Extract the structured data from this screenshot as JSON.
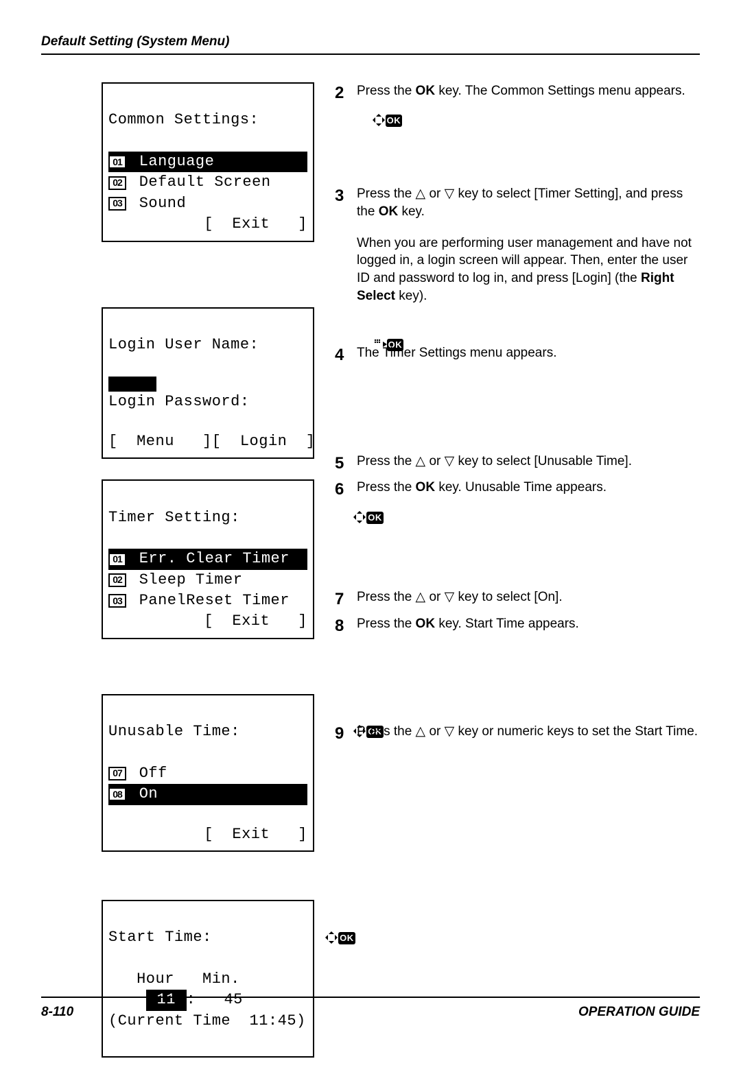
{
  "header": "Default Setting (System Menu)",
  "footer": {
    "page": "8-110",
    "guide": "OPERATION GUIDE"
  },
  "lcd1": {
    "title": "Common Settings:",
    "items": [
      {
        "num": "01",
        "label": " Language",
        "sel": true
      },
      {
        "num": "02",
        "label": " Default Screen",
        "sel": false
      },
      {
        "num": "03",
        "label": " Sound",
        "sel": false
      }
    ],
    "action_right": "[  Exit   ]"
  },
  "lcd2": {
    "title": "Login User Name:",
    "pw_label": "Login Password:",
    "menu": "[  Menu   ]",
    "login": "[  Login  ]"
  },
  "lcd3": {
    "title": "Timer Setting:",
    "items": [
      {
        "num": "01",
        "label": " Err. Clear Timer",
        "sel": true
      },
      {
        "num": "02",
        "label": " Sleep Timer",
        "sel": false
      },
      {
        "num": "03",
        "label": " PanelReset Timer",
        "sel": false
      }
    ],
    "action_right": "[  Exit   ]"
  },
  "lcd4": {
    "title": "Unusable Time:",
    "items": [
      {
        "num": "07",
        "label": " Off",
        "sel": false
      },
      {
        "num": "08",
        "label": " On",
        "sel": true
      }
    ],
    "action_right": "[  Exit   ]"
  },
  "lcd5": {
    "title": "Start Time:",
    "labels": "   Hour   Min.",
    "hour": "11",
    "min": "45",
    "current": "(Current Time  11:45)"
  },
  "steps": {
    "s2a": "Press the ",
    "s2b": " key. The Common Settings menu appears.",
    "s3a": "Press the ",
    "s3b": " or ",
    "s3c": " key to select [Timer Setting], and press the ",
    "s3d": " key.",
    "s3e": "When you are performing user management and have not logged in, a login screen will appear. Then, enter the user ID and password to log in, and press [Login] (the ",
    "s3f": " key).",
    "s4": "The Timer Settings menu appears.",
    "s5a": "Press the ",
    "s5b": " or ",
    "s5c": " key to select [Unusable Time].",
    "s6a": "Press the ",
    "s6b": " key. Unusable Time appears.",
    "s7a": "Press the ",
    "s7b": " or ",
    "s7c": " key to select [On].",
    "s8a": "Press the ",
    "s8b": " key. Start Time appears.",
    "s9a": "Press the ",
    "s9b": " or ",
    "s9c": " key or numeric keys to set the Start Time.",
    "ok_label": "OK",
    "right_select_label": "Right Select"
  }
}
